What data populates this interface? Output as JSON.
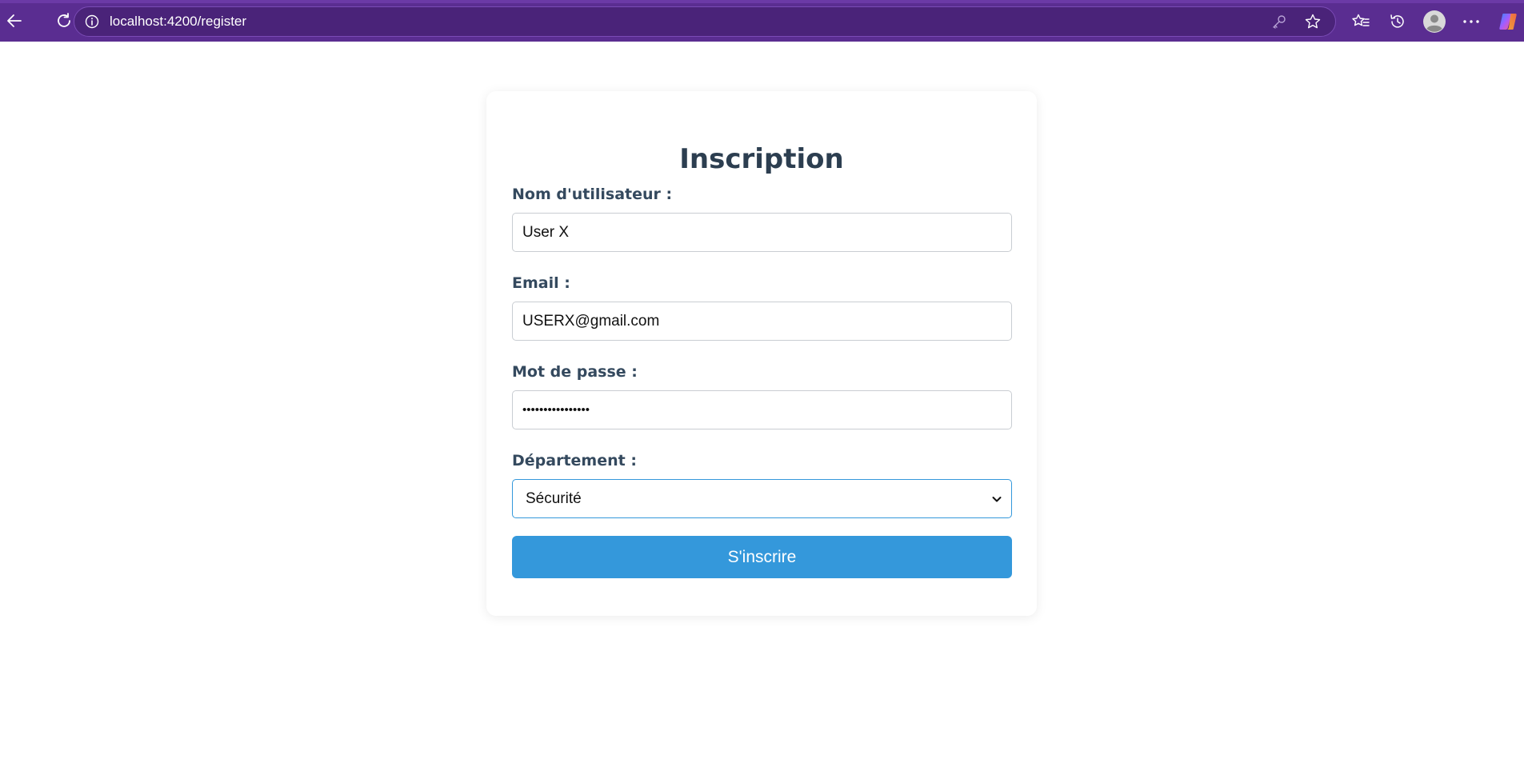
{
  "browser": {
    "url": "localhost:4200/register",
    "colors": {
      "chrome_bg": "#5a2d91",
      "address_bg": "#4a2379"
    },
    "icons": {
      "back": "back-arrow-icon",
      "reload": "reload-icon",
      "site_info": "info-icon",
      "password_key": "key-icon",
      "favorite": "star-icon",
      "favorites_list": "favorites-icon",
      "history": "history-icon",
      "profile": "profile-icon",
      "more": "more-icon",
      "copilot": "copilot-icon"
    }
  },
  "form": {
    "title": "Inscription",
    "username": {
      "label": "Nom d'utilisateur :",
      "value": "User X"
    },
    "email": {
      "label": "Email :",
      "value": "USERX@gmail.com"
    },
    "password": {
      "label": "Mot de passe :",
      "value": "••••••••••••••••"
    },
    "department": {
      "label": "Département :",
      "selected": "Sécurité"
    },
    "submit_label": "S'inscrire",
    "colors": {
      "title": "#2c3e50",
      "label": "#34495e",
      "accent": "#3498db"
    }
  }
}
